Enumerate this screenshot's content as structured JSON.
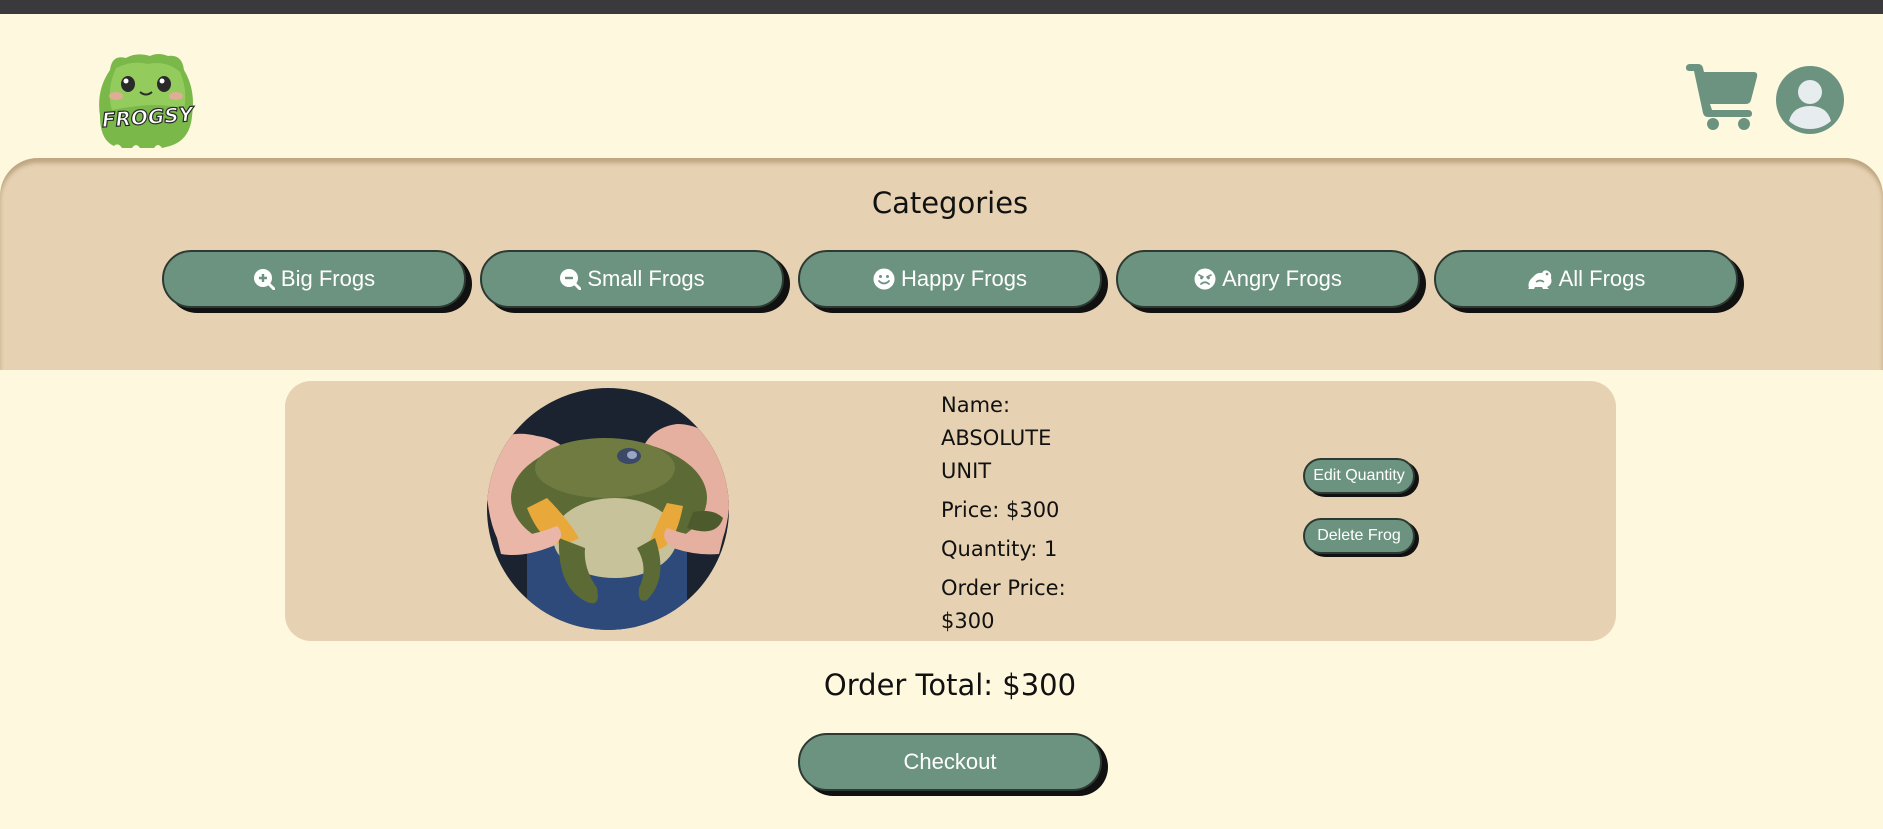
{
  "header": {
    "logo_text": "FROGSY",
    "cart_icon": "shopping-cart-icon",
    "user_icon": "user-circle-icon"
  },
  "categories": {
    "title": "Categories",
    "items": [
      {
        "label": "Big Frogs",
        "icon": "magnifier-plus-icon"
      },
      {
        "label": "Small Frogs",
        "icon": "magnifier-minus-icon"
      },
      {
        "label": "Happy Frogs",
        "icon": "smile-icon"
      },
      {
        "label": "Angry Frogs",
        "icon": "angry-face-icon"
      },
      {
        "label": "All Frogs",
        "icon": "frog-icon"
      }
    ]
  },
  "order": {
    "items": [
      {
        "name_line1": "Name:",
        "name_line2": "ABSOLUTE",
        "name_line3": "UNIT",
        "price": "Price: $300",
        "quantity": "Quantity: 1",
        "order_price_line1": "Order Price:",
        "order_price_line2": "$300",
        "edit_label": "Edit Quantity",
        "delete_label": "Delete Frog"
      }
    ],
    "total": "Order Total: $300",
    "checkout_label": "Checkout"
  },
  "colors": {
    "page_bg": "#fef8de",
    "band_bg": "#e6d2b2",
    "button_green": "#6c9380",
    "top_bar": "#3a3a3c"
  }
}
